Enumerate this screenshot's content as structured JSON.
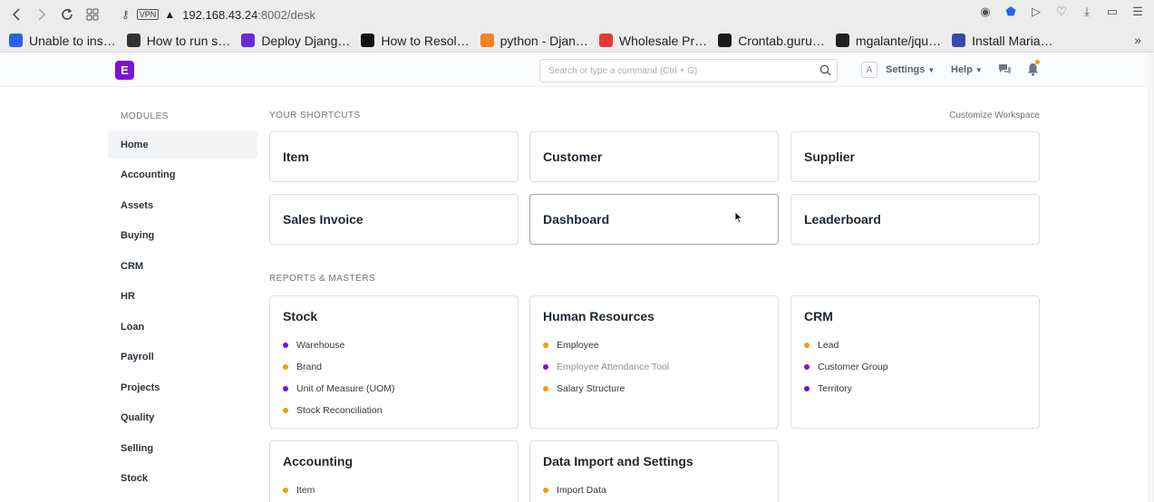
{
  "browser": {
    "url_host": "192.168.43.24",
    "url_path": ":8002/desk",
    "vpn_label": "VPN",
    "bookmarks": [
      {
        "label": "Unable to ins…",
        "icon": "ring-icon",
        "color": "#2563eb"
      },
      {
        "label": "How to run s…",
        "icon": "person-icon",
        "color": "#333333"
      },
      {
        "label": "Deploy Djang…",
        "icon": "globe-icon",
        "color": "#6d28d9"
      },
      {
        "label": "How to Resol…",
        "icon": "medium-icon",
        "color": "#111111"
      },
      {
        "label": "python - Djan…",
        "icon": "stackoverflow-icon",
        "color": "#f48024"
      },
      {
        "label": "Wholesale Pr…",
        "icon": "aliexpress-icon",
        "color": "#e53935"
      },
      {
        "label": "Crontab.guru…",
        "icon": "crontab-icon",
        "color": "#1b1b1b"
      },
      {
        "label": "mgalante/jqu…",
        "icon": "github-icon",
        "color": "#222222"
      },
      {
        "label": "Install Maria…",
        "icon": "mariadb-icon",
        "color": "#3949ab"
      }
    ]
  },
  "header": {
    "logo_letter": "E",
    "search_placeholder": "Search or type a command (Ctrl + G)",
    "avatar_letter": "A",
    "settings_label": "Settings",
    "help_label": "Help"
  },
  "sidebar": {
    "title": "MODULES",
    "items": [
      "Home",
      "Accounting",
      "Assets",
      "Buying",
      "CRM",
      "HR",
      "Loan",
      "Payroll",
      "Projects",
      "Quality",
      "Selling",
      "Stock"
    ]
  },
  "shortcuts": {
    "title": "YOUR SHORTCUTS",
    "customize_label": "Customize Workspace",
    "items": [
      "Item",
      "Customer",
      "Supplier",
      "Sales Invoice",
      "Dashboard",
      "Leaderboard"
    ]
  },
  "reports": {
    "title": "REPORTS & MASTERS",
    "colors": {
      "purple": "#7b13d6",
      "orange": "#f0a000"
    },
    "cards": [
      {
        "title": "Stock",
        "links": [
          {
            "label": "Warehouse",
            "dot": "purple"
          },
          {
            "label": "Brand",
            "dot": "orange"
          },
          {
            "label": "Unit of Measure (UOM)",
            "dot": "purple"
          },
          {
            "label": "Stock Reconciliation",
            "dot": "orange"
          }
        ]
      },
      {
        "title": "Human Resources",
        "links": [
          {
            "label": "Employee",
            "dot": "orange"
          },
          {
            "label": "Employee Attendance Tool",
            "dot": "purple"
          },
          {
            "label": "Salary Structure",
            "dot": "orange"
          }
        ]
      },
      {
        "title": "CRM",
        "links": [
          {
            "label": "Lead",
            "dot": "orange"
          },
          {
            "label": "Customer Group",
            "dot": "purple"
          },
          {
            "label": "Territory",
            "dot": "purple"
          }
        ]
      },
      {
        "title": "Accounting",
        "links": [
          {
            "label": "Item",
            "dot": "orange"
          }
        ]
      },
      {
        "title": "Data Import and Settings",
        "links": [
          {
            "label": "Import Data",
            "dot": "orange"
          }
        ]
      }
    ]
  }
}
